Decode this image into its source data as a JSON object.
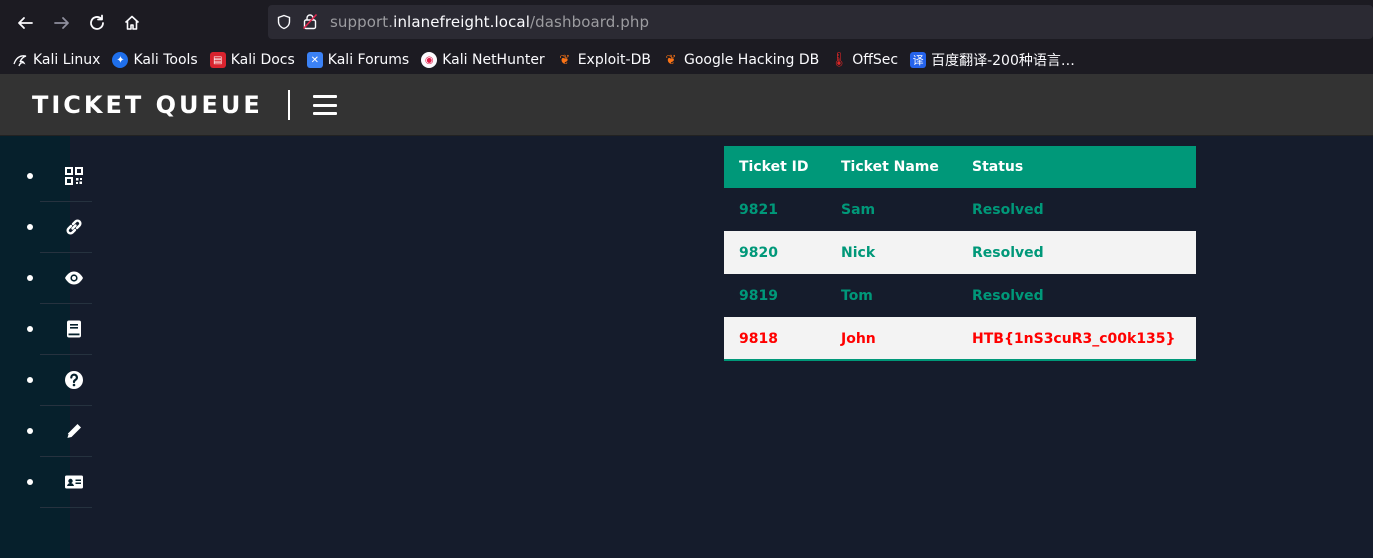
{
  "browser": {
    "url_prefix": "support.",
    "url_host": "inlanefreight.local",
    "url_path": "/dashboard.php"
  },
  "bookmarks": [
    {
      "label": "Kali Linux",
      "icon": "kali-dragon-icon",
      "color": "#1c1b22"
    },
    {
      "label": "Kali Tools",
      "icon": "kali-tools-icon",
      "color": "#1f6feb"
    },
    {
      "label": "Kali Docs",
      "icon": "kali-docs-icon",
      "color": "#d9232e"
    },
    {
      "label": "Kali Forums",
      "icon": "kali-forums-icon",
      "color": "#3b82f6"
    },
    {
      "label": "Kali NetHunter",
      "icon": "kali-nethunter-icon",
      "color": "#e11d48"
    },
    {
      "label": "Exploit-DB",
      "icon": "exploit-db-icon",
      "color": "#f97316"
    },
    {
      "label": "Google Hacking DB",
      "icon": "ghdb-icon",
      "color": "#f97316"
    },
    {
      "label": "OffSec",
      "icon": "offsec-icon",
      "color": "#dc2626"
    },
    {
      "label": "百度翻译-200种语言…",
      "icon": "baidu-translate-icon",
      "color": "#2563eb"
    }
  ],
  "header": {
    "title": "TICKET QUEUE"
  },
  "sidebar": {
    "items": [
      {
        "icon": "qr-code-icon"
      },
      {
        "icon": "link-icon"
      },
      {
        "icon": "eye-icon"
      },
      {
        "icon": "book-icon"
      },
      {
        "icon": "question-circle-icon"
      },
      {
        "icon": "pencil-icon"
      },
      {
        "icon": "id-card-icon"
      }
    ]
  },
  "table": {
    "headers": [
      "Ticket ID",
      "Ticket Name",
      "Status"
    ],
    "rows": [
      {
        "id": "9821",
        "name": "Sam",
        "status": "Resolved"
      },
      {
        "id": "9820",
        "name": "Nick",
        "status": "Resolved"
      },
      {
        "id": "9819",
        "name": "Tom",
        "status": "Resolved"
      },
      {
        "id": "9818",
        "name": "John",
        "status": "HTB{1nS3cuR3_c00k135}"
      }
    ]
  },
  "colors": {
    "accent": "#009879",
    "alert": "#ff0000",
    "background": "#151c2c",
    "sidebar": "#06202c"
  }
}
